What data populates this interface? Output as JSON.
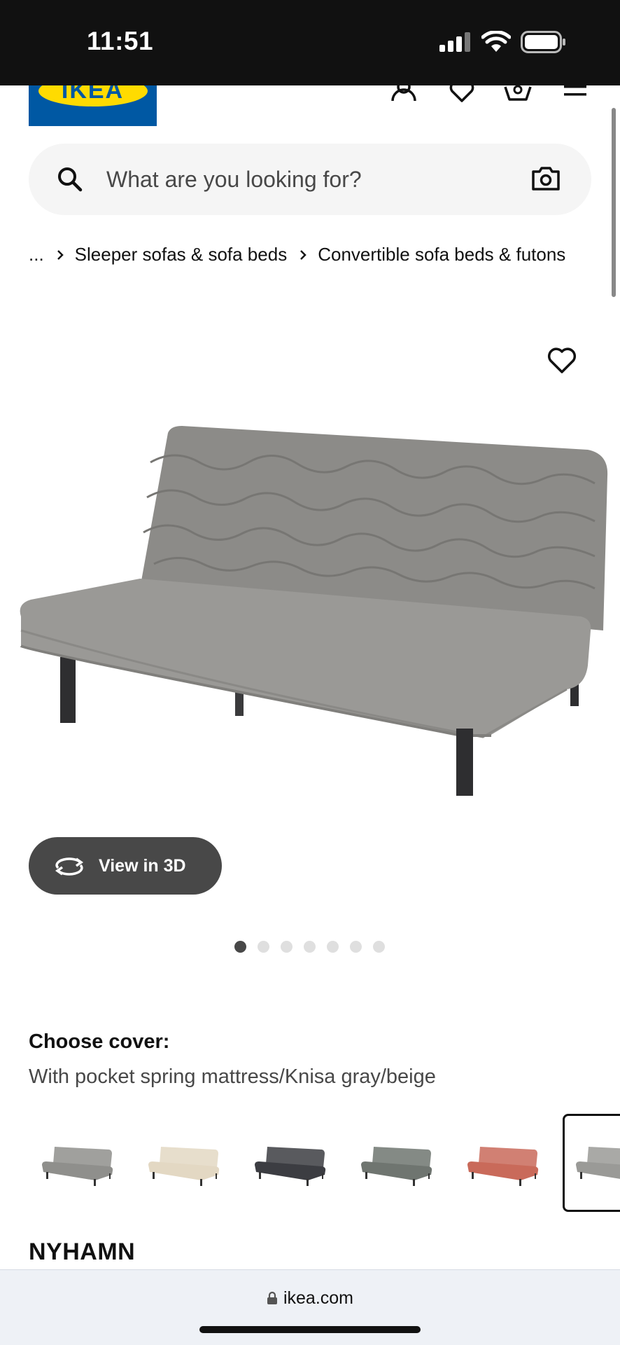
{
  "status_bar": {
    "time": "11:51"
  },
  "header": {
    "logo_text": "IKEA",
    "icons": [
      "profile-icon",
      "heart-icon",
      "cart-icon",
      "menu-icon"
    ]
  },
  "search": {
    "placeholder": "What are you looking for?"
  },
  "breadcrumb": {
    "ellipsis": "...",
    "items": [
      "Sleeper sofas & sofa beds",
      "Convertible sofa beds & futons"
    ]
  },
  "gallery": {
    "view3d_label": "View in 3D",
    "dot_count": 7,
    "active_dot": 0
  },
  "cover": {
    "title": "Choose cover:",
    "value": "With pocket spring mattress/Knisa gray/beige",
    "swatches": [
      {
        "name": "gray-quilted",
        "color": "#8f8f8c"
      },
      {
        "name": "beige",
        "color": "#e3d8c3"
      },
      {
        "name": "dark-gray",
        "color": "#3c3d42"
      },
      {
        "name": "green-gray",
        "color": "#6f7570"
      },
      {
        "name": "red",
        "color": "#c96a5a"
      },
      {
        "name": "gray-selected",
        "color": "#9a9a97"
      }
    ],
    "selected_index": 5
  },
  "product": {
    "name": "NYHAMN"
  },
  "browser": {
    "url": "ikea.com"
  },
  "colors": {
    "ikea_blue": "#0058a3",
    "ikea_yellow": "#ffdb00",
    "button_dark": "#484848"
  }
}
